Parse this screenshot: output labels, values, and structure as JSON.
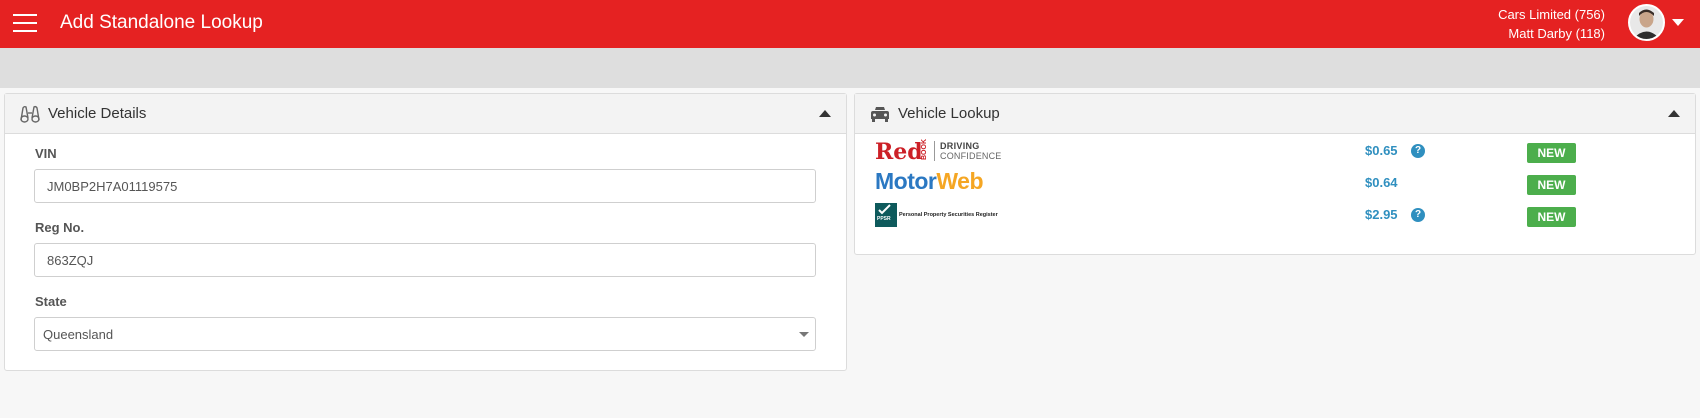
{
  "header": {
    "title": "Add Standalone Lookup",
    "company": "Cars Limited (756)",
    "user": "Matt Darby (118)"
  },
  "vehicle_details": {
    "title": "Vehicle Details",
    "vin_label": "VIN",
    "vin_value": "JM0BP2H7A01119575",
    "reg_label": "Reg No.",
    "reg_value": "863ZQJ",
    "state_label": "State",
    "state_value": "Queensland"
  },
  "vehicle_lookup": {
    "title": "Vehicle Lookup",
    "providers": [
      {
        "logo": "redbook-logo",
        "logo_main": "Red",
        "logo_side": "BOOK",
        "logo_tag1": "DRIVING",
        "logo_tag2": "CONFIDENCE",
        "price": "$0.65",
        "help": true,
        "badge": "NEW"
      },
      {
        "logo": "motorweb-logo",
        "logo_main1": "Motor",
        "logo_main2": "Web",
        "price": "$0.64",
        "help": false,
        "badge": "NEW"
      },
      {
        "logo": "ppsr-logo",
        "logo_mark": "PPSR",
        "logo_text": "Personal Property Securities Register",
        "price": "$2.95",
        "help": true,
        "badge": "NEW"
      }
    ]
  },
  "help_glyph": "?",
  "colors": {
    "brand_red": "#e52222",
    "price_blue": "#2f8fbf",
    "badge_green": "#4cae4c"
  }
}
